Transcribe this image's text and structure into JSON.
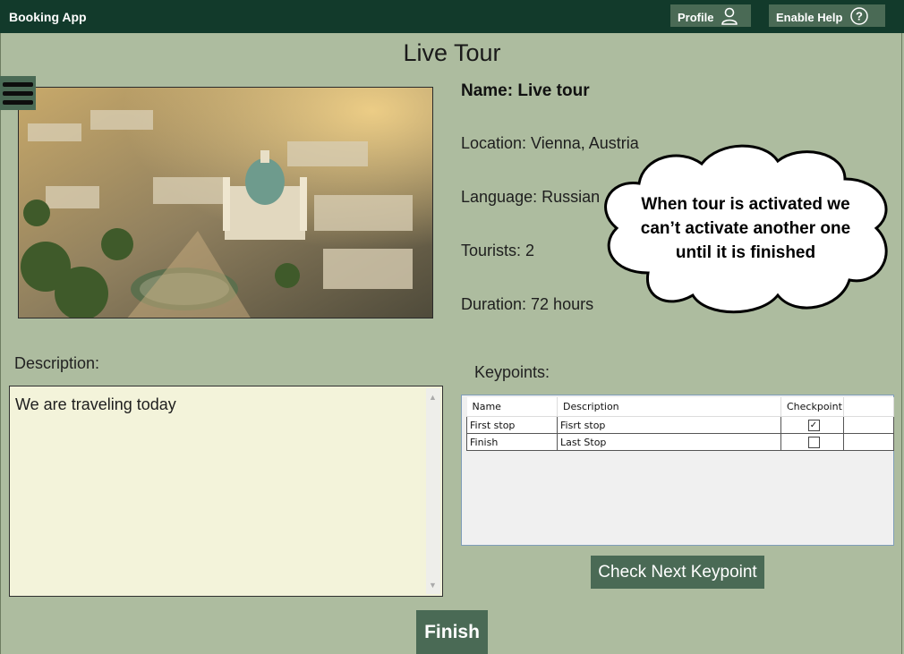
{
  "app": {
    "name": "Booking App"
  },
  "topbar": {
    "profile_label": "Profile",
    "profile_icon": "user-icon",
    "help_label": "Enable Help",
    "help_icon": "question-circle-icon"
  },
  "page": {
    "title": "Live Tour"
  },
  "tour": {
    "name": "Name: Live tour",
    "location": "Location: Vienna, Austria",
    "language": "Language: Russian",
    "tourists": "Tourists: 2",
    "duration": "Duration: 72 hours"
  },
  "description": {
    "label": "Description:",
    "value": "We are traveling today"
  },
  "keypoints": {
    "label": "Keypoints:",
    "columns": [
      "Name",
      "Description",
      "Checkpoint"
    ],
    "rows": [
      {
        "name": "First stop",
        "description": "Fisrt stop",
        "checked": true
      },
      {
        "name": "Finish",
        "description": "Last Stop",
        "checked": false
      }
    ]
  },
  "buttons": {
    "check_next": "Check Next Keypoint",
    "finish": "Finish"
  },
  "note": {
    "line1": "When tour is activated we",
    "line2": "can’t activate another one",
    "line3": "until it is finished"
  },
  "colors": {
    "topbar": "#123a2b",
    "background": "#adbc9f",
    "button": "#4a6a55",
    "description_bg": "#f3f3da"
  }
}
